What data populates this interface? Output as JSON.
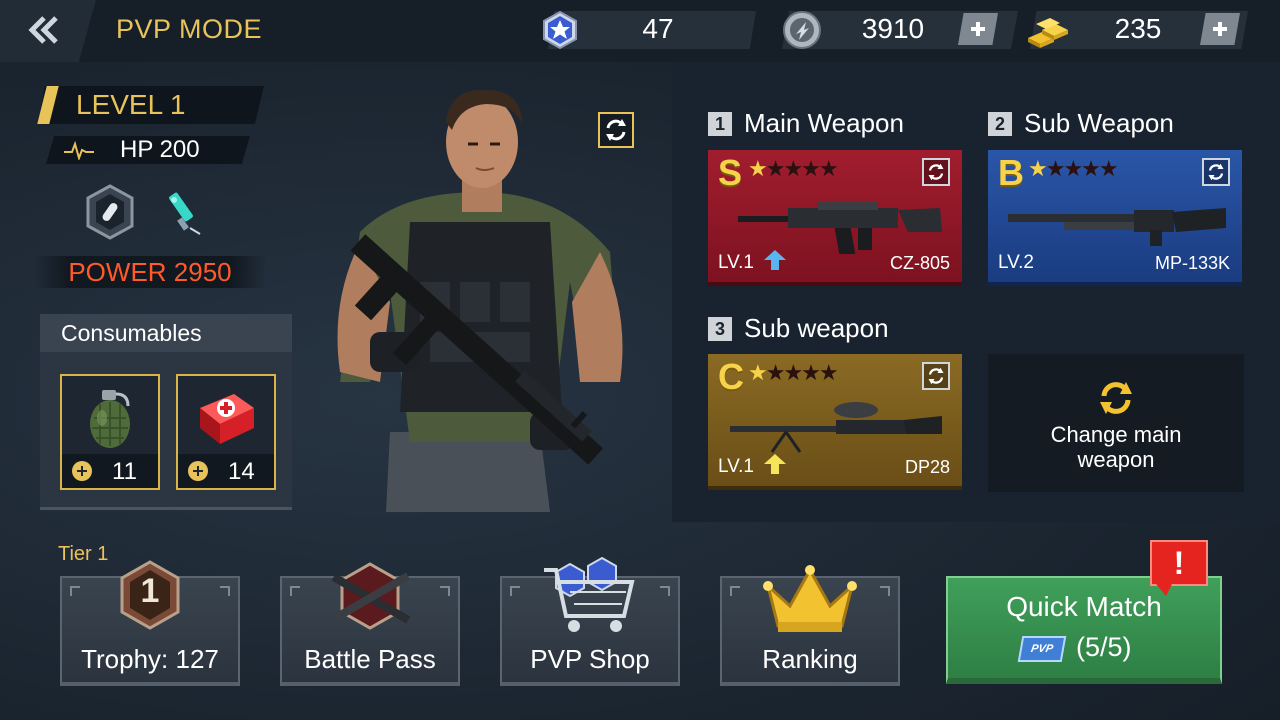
{
  "header": {
    "title": "PVP MODE",
    "resources": [
      {
        "icon": "star-medal-icon",
        "value": "47"
      },
      {
        "icon": "silver-coin-icon",
        "value": "3910"
      },
      {
        "icon": "gold-bars-icon",
        "value": "235"
      }
    ]
  },
  "player": {
    "level": "LEVEL 1",
    "hp": "HP 200",
    "power": "POWER 2950"
  },
  "consumables": {
    "title": "Consumables",
    "items": [
      {
        "icon": "grenade-icon",
        "count": "11"
      },
      {
        "icon": "medkit-icon",
        "count": "14"
      }
    ]
  },
  "weapons": [
    {
      "num": "1",
      "label": "Main Weapon",
      "grade": "S",
      "stars": 1,
      "level": "LV.1",
      "name": "CZ-805"
    },
    {
      "num": "2",
      "label": "Sub Weapon",
      "grade": "B",
      "stars": 1,
      "level": "LV.2",
      "name": "MP-133K"
    },
    {
      "num": "3",
      "label": "Sub weapon",
      "grade": "C",
      "stars": 1,
      "level": "LV.1",
      "name": "DP28"
    }
  ],
  "change_main": {
    "line1": "Change main",
    "line2": "weapon"
  },
  "bottom": {
    "tier": "Tier 1",
    "trophy": "Trophy: 127",
    "battle_pass": "Battle Pass",
    "pvp_shop": "PVP Shop",
    "ranking": "Ranking",
    "quick_match": "Quick Match",
    "ticket": "PVP",
    "quick_match_count": "(5/5)",
    "alert": "!",
    "trophy_rank": "1"
  },
  "colors": {
    "accent_gold": "#e8c35a",
    "power_red": "#ff5a2a",
    "grade_s": "#a11d2e",
    "grade_b": "#2a56a8",
    "grade_c": "#8a6a24",
    "quick_match_green": "#3fa05a"
  }
}
